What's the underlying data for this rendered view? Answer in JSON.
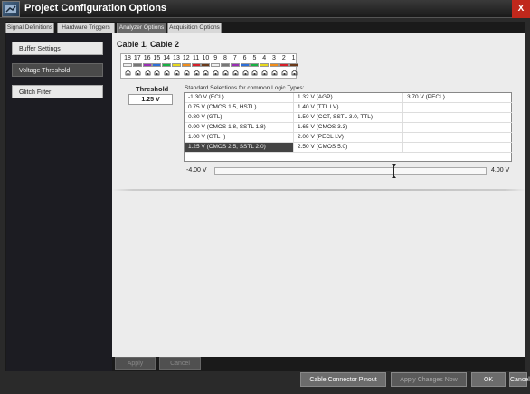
{
  "window": {
    "title": "Project Configuration Options",
    "close_label": "X"
  },
  "tabs": [
    {
      "label": "Signal Definitions",
      "active": false
    },
    {
      "label": "Hardware Triggers",
      "active": false
    },
    {
      "label": "Analyzer Options",
      "active": true
    },
    {
      "label": "Acquisition Options",
      "active": false
    }
  ],
  "sidebar": {
    "items": [
      {
        "label": "Buffer Settings",
        "active": false
      },
      {
        "label": "Voltage Threshold",
        "active": true
      },
      {
        "label": "Glitch Filter",
        "active": false
      }
    ]
  },
  "content": {
    "cable_title": "Cable 1, Cable 2",
    "pins": [
      {
        "num": "18",
        "color": "#f0f0f0"
      },
      {
        "num": "17",
        "color": "#777777"
      },
      {
        "num": "16",
        "color": "#9a2fb4"
      },
      {
        "num": "15",
        "color": "#2d6fd8"
      },
      {
        "num": "14",
        "color": "#19b243"
      },
      {
        "num": "13",
        "color": "#e8d81c"
      },
      {
        "num": "12",
        "color": "#f08d1b"
      },
      {
        "num": "11",
        "color": "#d5202a"
      },
      {
        "num": "10",
        "color": "#6b3a1a"
      },
      {
        "num": "9",
        "color": "#f0f0f0"
      },
      {
        "num": "8",
        "color": "#777777"
      },
      {
        "num": "7",
        "color": "#9a2fb4"
      },
      {
        "num": "6",
        "color": "#2d6fd8"
      },
      {
        "num": "5",
        "color": "#19b243"
      },
      {
        "num": "4",
        "color": "#e8d81c"
      },
      {
        "num": "3",
        "color": "#f08d1b"
      },
      {
        "num": "2",
        "color": "#d5202a"
      },
      {
        "num": "1",
        "color": "#6b3a1a"
      }
    ],
    "threshold_label": "Threshold",
    "threshold_value": "1.25 V",
    "std_label": "Standard Selections for common Logic Types:",
    "selections": [
      [
        "-1.30 V   (ECL)",
        "1.32 V   (AGP)",
        "3.70 V   (PECL)"
      ],
      [
        "0.75 V   (CMOS 1.5, HSTL)",
        "1.40 V   (TTL LV)",
        ""
      ],
      [
        "0.80 V   (GTL)",
        "1.50 V   (CCT, SSTL 3.0, TTL)",
        ""
      ],
      [
        "0.90 V   (CMOS 1.8, SSTL 1.8)",
        "1.65 V   (CMOS 3.3)",
        ""
      ],
      [
        "1.00 V   (GTL+)",
        "2.00 V   (PECL LV)",
        ""
      ],
      [
        "1.25 V   (CMOS 2.5, SSTL 2.0)",
        "2.50 V   (CMOS 5.0)",
        ""
      ]
    ],
    "selected": "1.25 V   (CMOS 2.5, SSTL 2.0)",
    "slider": {
      "min_label": "-4.00 V",
      "max_label": "4.00 V",
      "min": -4.0,
      "max": 4.0,
      "value": 1.25
    },
    "apply_label": "Apply",
    "cancel_label": "Cancel"
  },
  "footer": {
    "cable_pinout_label": "Cable Connector Pinout",
    "apply_changes_label": "Apply Changes Now",
    "ok_label": "OK",
    "cancel_label": "Cancel"
  },
  "colors": {
    "accent": "#c0281c",
    "selected_row": "#444444"
  }
}
